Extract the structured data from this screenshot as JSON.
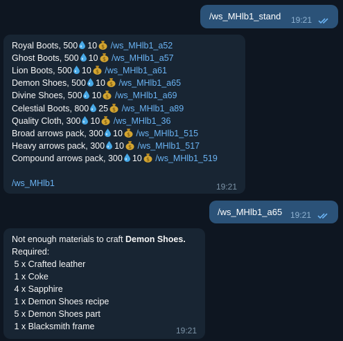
{
  "colors": {
    "background": "#0e1621",
    "outgoing_bubble": "#2b5278",
    "incoming_bubble": "#182533",
    "link": "#6ab3f3",
    "drop": "#47a8e6",
    "bag": "#d4a531"
  },
  "icons": [
    "water-drop-icon",
    "money-bag-icon",
    "double-check-icon"
  ],
  "messages": {
    "out1": {
      "text": "/ws_MHlb1_stand",
      "time": "19:21"
    },
    "shop": {
      "items": [
        {
          "name": "Royal Boots, 500",
          "gold": "10",
          "command": "/ws_MHlb1_a52"
        },
        {
          "name": "Ghost Boots, 500",
          "gold": "10",
          "command": "/ws_MHlb1_a57"
        },
        {
          "name": "Lion Boots, 500",
          "gold": "10",
          "command": "/ws_MHlb1_a61"
        },
        {
          "name": "Demon Shoes, 500",
          "gold": "10",
          "command": "/ws_MHlb1_a65"
        },
        {
          "name": "Divine Shoes, 500",
          "gold": "10",
          "command": "/ws_MHlb1_a69"
        },
        {
          "name": "Celestial Boots, 800",
          "gold": "25",
          "command": "/ws_MHlb1_a89"
        },
        {
          "name": "Quality Cloth, 300",
          "gold": "10",
          "command": "/ws_MHlb1_36"
        },
        {
          "name": "Broad arrows pack, 300",
          "gold": "10",
          "command": "/ws_MHlb1_515"
        },
        {
          "name": "Heavy arrows pack, 300",
          "gold": "10",
          "command": "/ws_MHlb1_517"
        },
        {
          "name": "Compound arrows pack, 300",
          "gold": "10",
          "command": "/ws_MHlb1_519"
        }
      ],
      "footer_command": "/ws_MHlb1",
      "time": "19:21"
    },
    "out2": {
      "text": "/ws_MHlb1_a65",
      "time": "19:21"
    },
    "craft": {
      "intro": "Not enough materials to craft ",
      "item": "Demon Shoes.",
      "required_label": "Required:",
      "requirements": [
        " 5 x Crafted leather",
        " 1 x Coke",
        " 4 x Sapphire",
        " 1 x Demon Shoes recipe",
        " 5 x Demon Shoes part",
        " 1 x Blacksmith frame"
      ],
      "time": "19:21"
    }
  }
}
